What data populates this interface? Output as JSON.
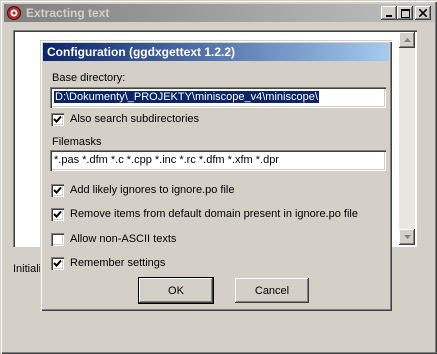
{
  "window": {
    "title": "Extracting text",
    "status_text": "Initializ"
  },
  "dialog": {
    "title": "Configuration (ggdxgettext 1.2.2)",
    "base_directory_label": "Base directory:",
    "base_directory_value": "D:\\Dokumenty\\_PROJEKTY\\miniscope_v4\\miniscope\\",
    "also_search_label": "Also search subdirectories",
    "filemasks_label": "Filemasks",
    "filemasks_value": "*.pas *.dfm *.c *.cpp *.inc *.rc *.dfm *.xfm *.dpr",
    "options": [
      {
        "label": "Add likely ignores to ignore.po file",
        "checked": true
      },
      {
        "label": "Remove items from default domain present in ignore.po file",
        "checked": true
      },
      {
        "label": "Allow non-ASCII texts",
        "checked": false
      },
      {
        "label": "Remember settings",
        "checked": true
      }
    ],
    "also_search_checked": true,
    "ok_label": "OK",
    "cancel_label": "Cancel"
  },
  "colors": {
    "inactive_title_start": "#808080",
    "active_title_start": "#0a246a",
    "active_title_end": "#a6caf0",
    "face": "#d4d0c8"
  },
  "icons": [
    "app-icon",
    "minimize-icon",
    "maximize-icon",
    "close-icon",
    "scroll-up-icon",
    "scroll-down-icon",
    "checkmark-icon"
  ]
}
